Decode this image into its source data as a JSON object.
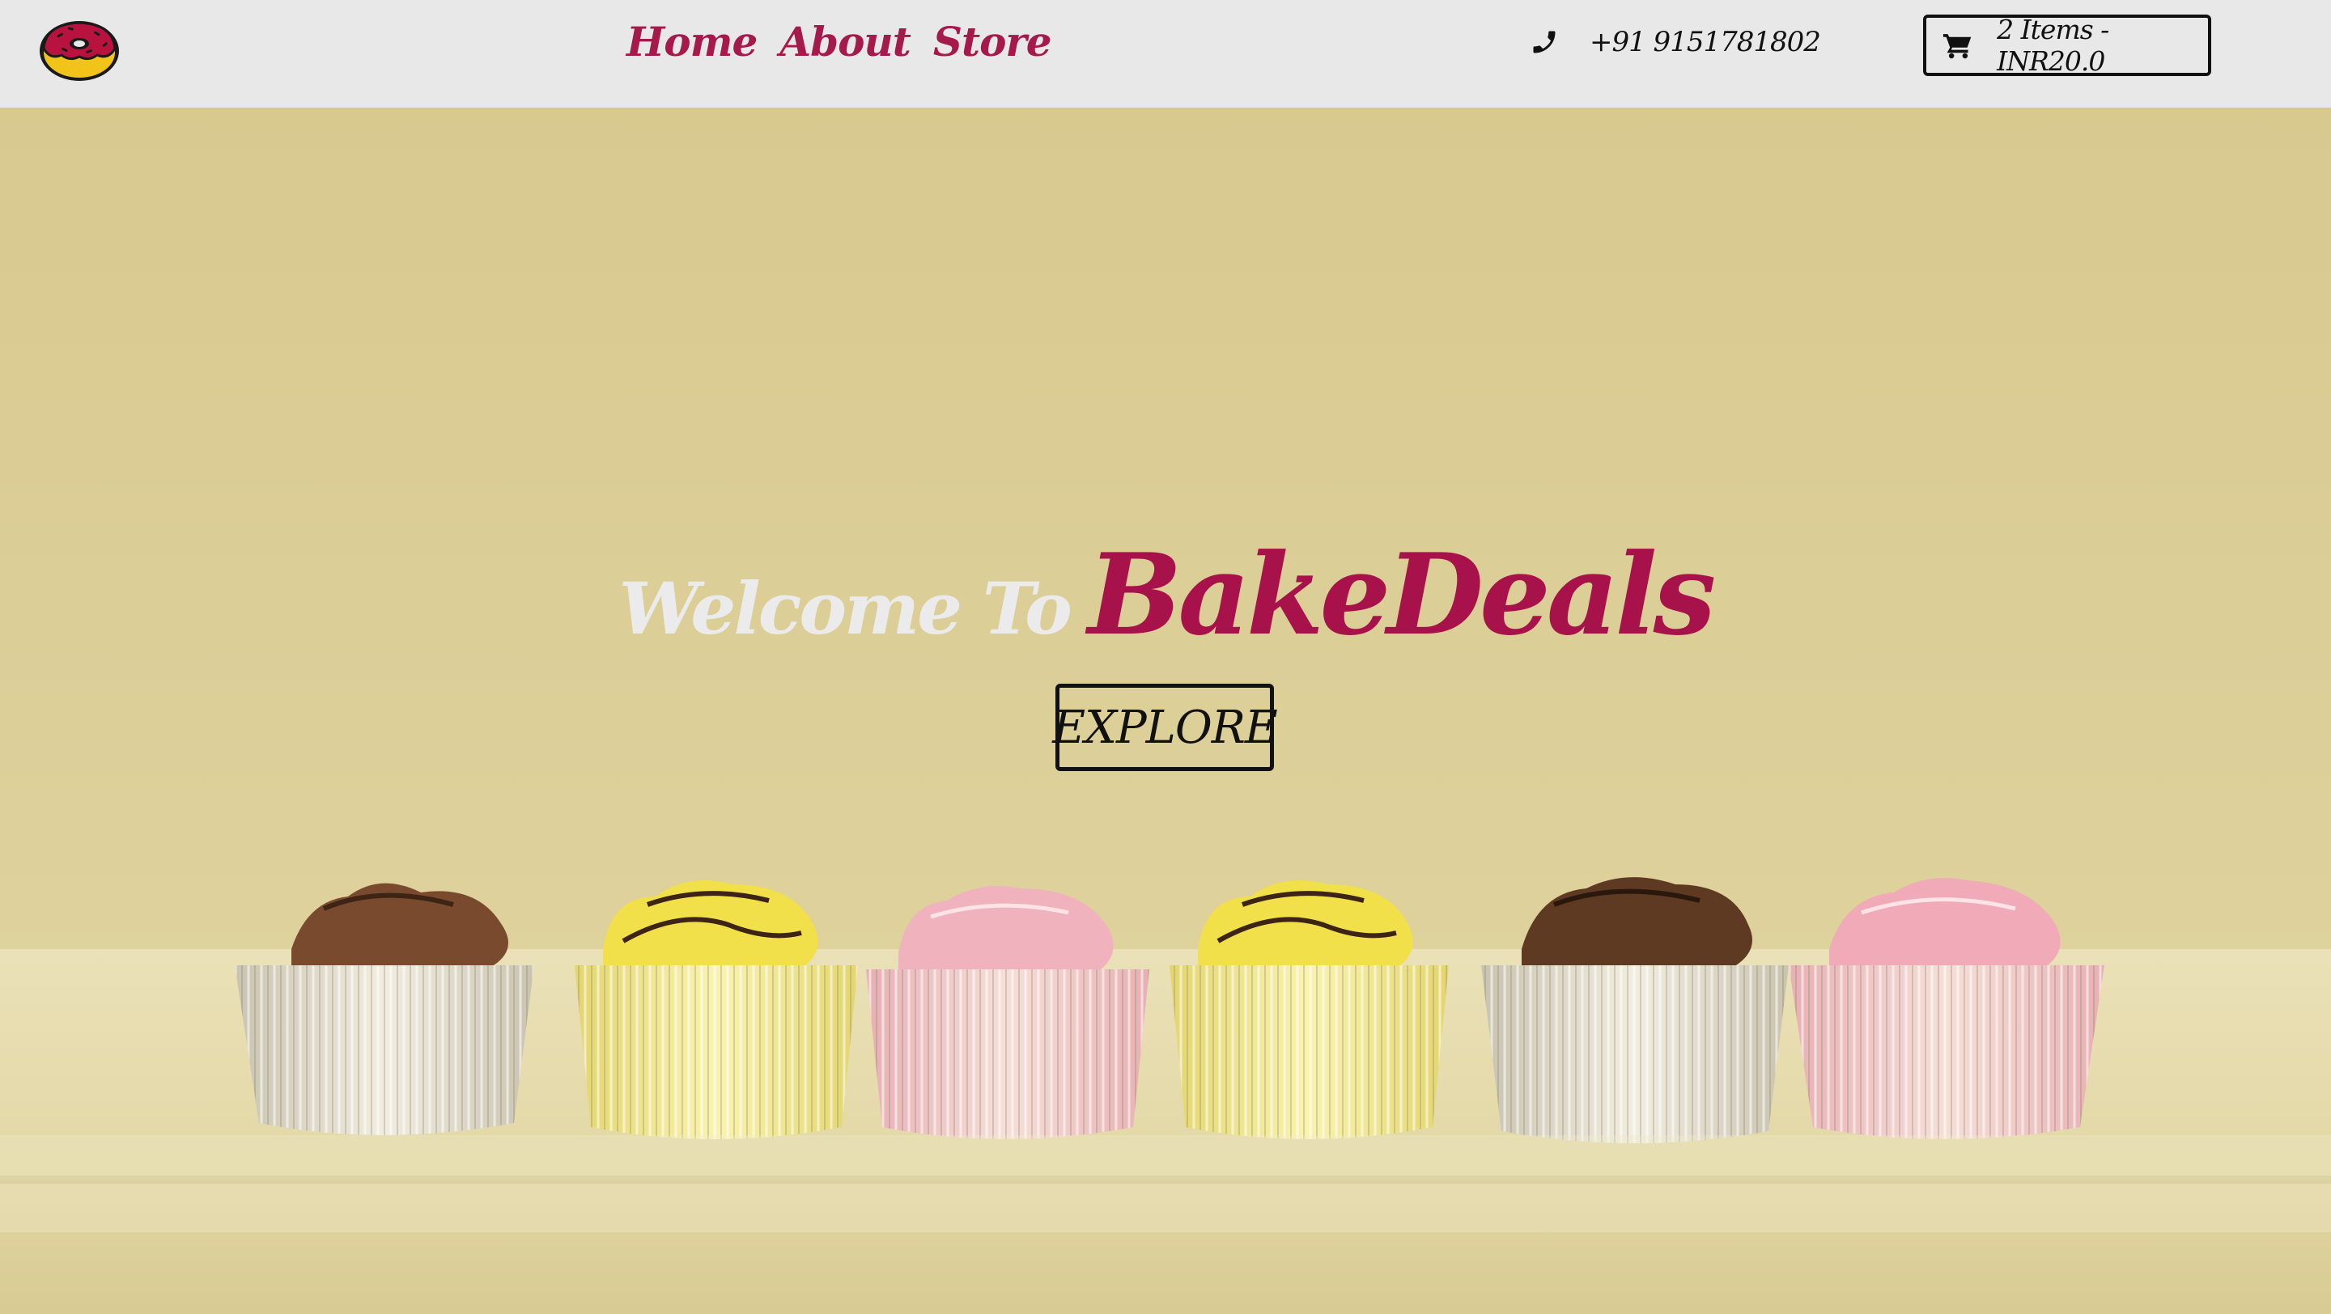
{
  "brand": {
    "logo_icon": "donut-icon",
    "primary_color": "#a8124a"
  },
  "nav": {
    "items": [
      {
        "label": "Home"
      },
      {
        "label": "About"
      },
      {
        "label": "Store"
      }
    ]
  },
  "contact": {
    "icon": "phone-icon",
    "phone": "+91 9151781802"
  },
  "cart": {
    "icon": "shopping-cart-icon",
    "label": "2 Items - INR20.0"
  },
  "hero": {
    "welcome_text": "Welcome To",
    "brand_text": "BakeDeals",
    "explore_label": "EXPLORE",
    "background": "cupcakes-row-photo"
  }
}
